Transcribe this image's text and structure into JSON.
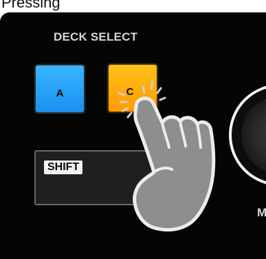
{
  "top_caption": "Pressing",
  "section_label": "DECK SELECT",
  "pads": {
    "a_label": "A",
    "a_color": "#1f9bf5",
    "c_label": "C",
    "c_color": "#ffac0a"
  },
  "shift_label": "SHIFT",
  "jog_caption": "M",
  "panel_color": "#050505",
  "icons": {
    "hand": "pointing-hand-icon",
    "press": "press-indicator-icon"
  }
}
